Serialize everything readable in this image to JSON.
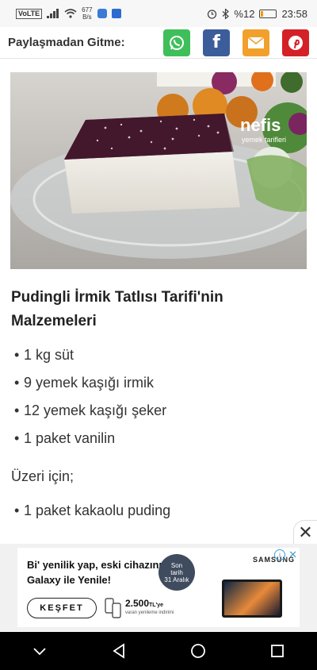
{
  "status_bar": {
    "network_tag": "VoLTE",
    "data_speed": "677",
    "data_unit": "B/s",
    "battery": "%12",
    "time": "23:58"
  },
  "share_bar": {
    "title": "Paylaşmadan Gitme:",
    "buttons": [
      {
        "name": "whatsapp",
        "color": "#3fbf5a"
      },
      {
        "name": "facebook",
        "color": "#3b5d9a",
        "glyph": "f"
      },
      {
        "name": "email",
        "color": "#f2a02c"
      },
      {
        "name": "pinterest",
        "color": "#d42127"
      }
    ]
  },
  "hero": {
    "watermark_main": "nefis",
    "watermark_sub": "yemek tarifleri"
  },
  "recipe": {
    "heading": "Pudingli İrmik Tatlısı Tarifi'nin Malzemeleri",
    "ingredients": [
      "1 kg süt",
      "9 yemek kaşığı irmik",
      "12 yemek kaşığı şeker",
      "1 paket vanilin"
    ],
    "topping_title": "Üzeri için;",
    "topping_ingredients": [
      "1 paket kakaolu puding"
    ]
  },
  "ad": {
    "line1": "Bi' yenilik yap, eski cihazını",
    "line2": "Galaxy ile Yenile!",
    "badge_line1": "Son",
    "badge_line2": "tarih",
    "badge_line3": "31 Aralık",
    "cta": "KEŞFET",
    "price": "2.500",
    "price_unit": "TL'ye",
    "price_sub": "varan yenileme indirimi",
    "brand": "SAMSUNG"
  },
  "close_glyph": "✕"
}
